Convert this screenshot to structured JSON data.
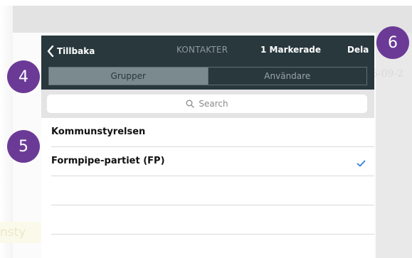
{
  "background": {
    "date_fragment": "6-09-2",
    "text_fragment": "nsty"
  },
  "navbar": {
    "back_label": "Tillbaka",
    "title": "KONTAKTER",
    "marked": "1 Markerade",
    "share_label": "Dela"
  },
  "segment": {
    "items": [
      {
        "label": "Grupper",
        "active": true
      },
      {
        "label": "Användare",
        "active": false
      }
    ]
  },
  "search": {
    "placeholder": "Search",
    "icon": "search-icon"
  },
  "list": {
    "items": [
      {
        "label": "Kommunstyrelsen",
        "checked": false
      },
      {
        "label": "Formpipe-partiet (FP)",
        "checked": true
      },
      {
        "label": "",
        "checked": false
      },
      {
        "label": "",
        "checked": false
      }
    ]
  },
  "annotations": {
    "badge_4": "4",
    "badge_5": "5",
    "badge_6": "6"
  },
  "colors": {
    "navbar": "#28383d",
    "segment_active": "#7a8a8f",
    "checkmark": "#2f7fe0",
    "badge": "#6b3a96"
  }
}
